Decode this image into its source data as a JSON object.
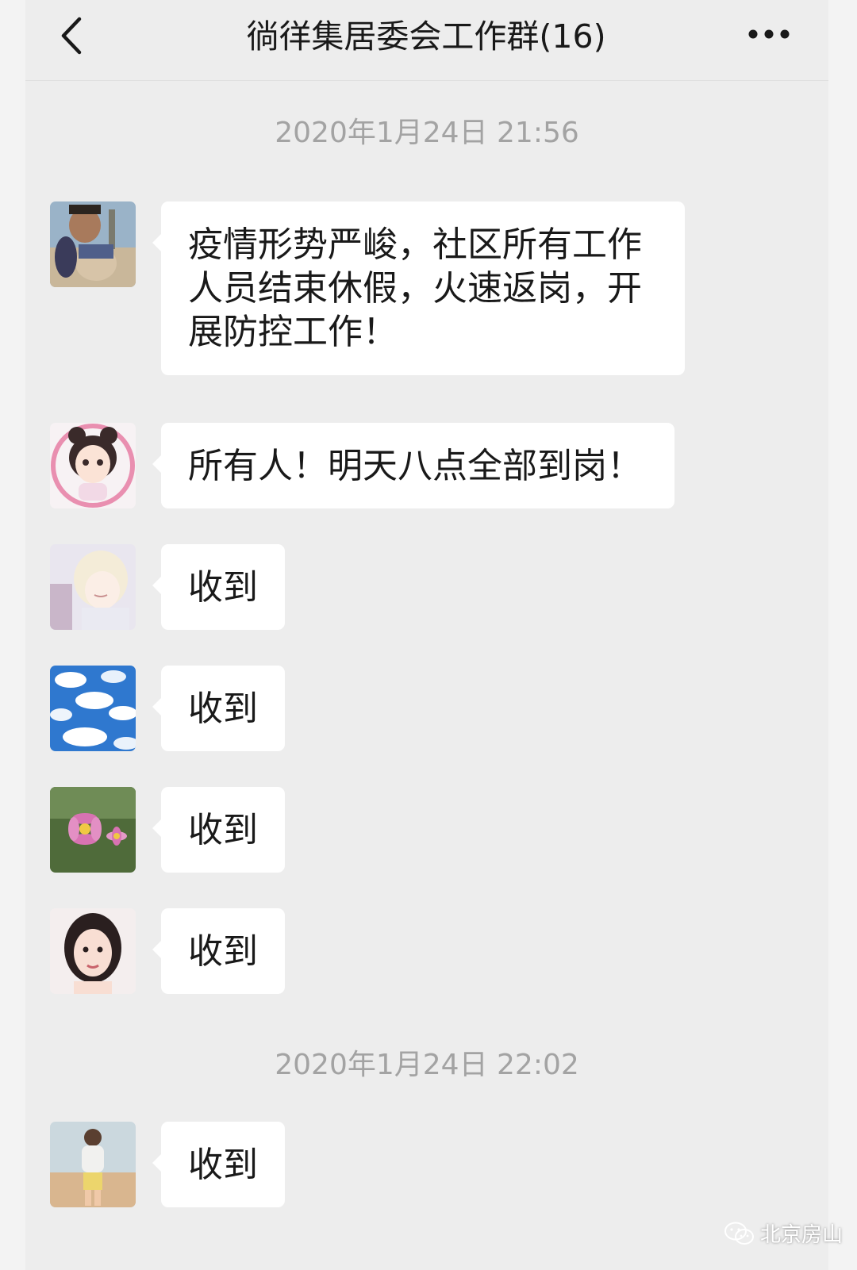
{
  "header": {
    "title": "徜徉集居委会工作群(16)",
    "back_icon": "chevron-left-icon",
    "more_icon": "more-icon"
  },
  "timestamps": [
    "2020年1月24日 21:56",
    "2020年1月24日 22:02"
  ],
  "messages": [
    {
      "avatar": "avatar-man-with-baby",
      "text": "疫情形势严峻，社区所有工作人员结束休假，火速返岗，开展防控工作！"
    },
    {
      "avatar": "avatar-cartoon-girl",
      "text": "所有人！明天八点全部到岗！"
    },
    {
      "avatar": "avatar-anime-girl",
      "text": "收到"
    },
    {
      "avatar": "avatar-blue-sky",
      "text": "收到"
    },
    {
      "avatar": "avatar-pink-flower",
      "text": "收到"
    },
    {
      "avatar": "avatar-woman-portrait",
      "text": "收到"
    },
    {
      "avatar": "avatar-beach-woman",
      "text": "收到"
    }
  ],
  "watermark": {
    "text": "北京房山",
    "icon": "wechat-icon"
  },
  "colors": {
    "background": "#ededed",
    "bubble": "#ffffff",
    "text": "#191919",
    "timestamp": "#a3a3a3"
  }
}
